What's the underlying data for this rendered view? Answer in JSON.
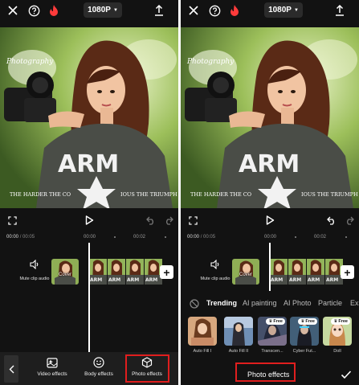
{
  "screens": [
    {
      "topbar": {
        "resolution": "1080P",
        "icons": [
          "close-icon",
          "help-icon",
          "flame-icon",
          "export-icon"
        ]
      },
      "preview": {
        "watermark": "Photography",
        "caption": "THE HARDER THE CO",
        "caption_right": "IOUS THE TRIUMPH",
        "shirt_text": "ARM"
      },
      "timeline": {
        "current_time": "00:00",
        "total_time": "/ 00:05",
        "ruler_labels": [
          "00:00",
          "00:02"
        ],
        "mute_label": "Mute clip audio",
        "cover_label": "Cover"
      },
      "toolbar": {
        "items": [
          {
            "label": "Video effects",
            "icon": "video-effects-icon"
          },
          {
            "label": "Body effects",
            "icon": "smiley-face-icon"
          },
          {
            "label": "Photo effects",
            "icon": "cube-icon"
          }
        ]
      }
    },
    {
      "topbar": {
        "resolution": "1080P",
        "icons": [
          "close-icon",
          "help-icon",
          "flame-icon",
          "export-icon"
        ]
      },
      "preview": {
        "watermark": "Photography",
        "caption": "THE HARDER THE CO",
        "caption_right": "IOUS THE TRIUMPH",
        "shirt_text": "ARM"
      },
      "timeline": {
        "current_time": "00:00",
        "total_time": "/ 00:05",
        "ruler_labels": [
          "00:00",
          "00:02"
        ],
        "mute_label": "Mute clip audio",
        "cover_label": "Cover"
      },
      "effects_panel": {
        "tabs": [
          "Trending",
          "AI painting",
          "AI Photo",
          "Particle",
          "Exp"
        ],
        "active_tab": "Trending",
        "items": [
          {
            "label": "Auto Fill I",
            "free": false
          },
          {
            "label": "Auto Fill II",
            "free": false
          },
          {
            "label": "Transcen...",
            "free": true
          },
          {
            "label": "Cyber Fut...",
            "free": true
          },
          {
            "label": "Doll",
            "free": true
          }
        ],
        "free_badge": "Free",
        "title": "Photo effects"
      }
    }
  ],
  "colors": {
    "background": "#121212",
    "highlight": "#e01e1e",
    "accent_flame": "#ff3b3b"
  }
}
